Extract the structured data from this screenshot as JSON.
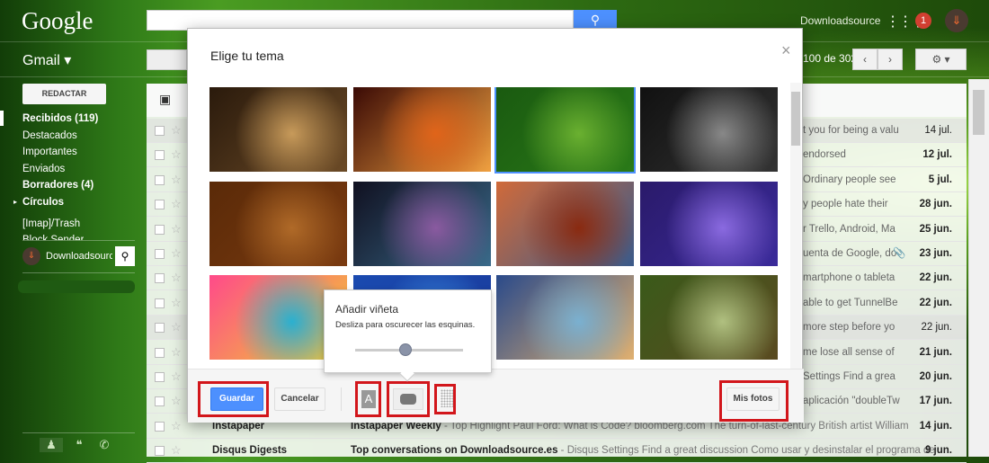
{
  "header": {
    "logo": "Google",
    "search_button_icon": "search-icon",
    "username": "Downloadsource",
    "notifications": "1",
    "app_label": "Gmail ▾",
    "page_count": "100 de 302"
  },
  "sidebar": {
    "compose": "REDACTAR",
    "items": [
      {
        "label": "Recibidos (119)",
        "bold": true
      },
      {
        "label": "Destacados",
        "bold": false
      },
      {
        "label": "Importantes",
        "bold": false
      },
      {
        "label": "Enviados",
        "bold": false
      },
      {
        "label": "Borradores (4)",
        "bold": true
      },
      {
        "label": "Círculos",
        "bold": true
      },
      {
        "label": "[Imap]/Trash",
        "bold": false
      },
      {
        "label": "Block Sender",
        "bold": false
      }
    ],
    "hangouts_name": "Downloadsource"
  },
  "emails": [
    {
      "snippet": "t you for being a valu",
      "date": "14 jul.",
      "read": true
    },
    {
      "snippet": "endorsed",
      "date": "12 jul.",
      "read": false
    },
    {
      "snippet": "Ordinary people see",
      "date": "5 jul.",
      "read": false
    },
    {
      "snippet": "y people hate their",
      "date": "28 jun.",
      "read": false
    },
    {
      "snippet": "r Trello, Android, Ma",
      "date": "25 jun.",
      "read": false
    },
    {
      "snippet": "uenta de Google, do",
      "date": "23 jun.",
      "read": false,
      "attachment": true
    },
    {
      "snippet": "martphone o tableta",
      "date": "22 jun.",
      "read": false
    },
    {
      "snippet": "able to get TunnelBe",
      "date": "22 jun.",
      "read": false
    },
    {
      "snippet": "more step before yo",
      "date": "22 jun.",
      "read": true
    },
    {
      "snippet": "me lose all sense of",
      "date": "21 jun.",
      "read": false
    },
    {
      "snippet": "Settings Find a grea",
      "date": "20 jun.",
      "read": false
    },
    {
      "snippet": "aplicación \"doubleTw",
      "date": "17 jun.",
      "read": false
    },
    {
      "sender": "Instapaper",
      "subject": "Instapaper Weekly",
      "snippet": " - Top Highlight Paul Ford: What is Code? bloomberg.com The turn-of-last-century British artist William",
      "date": "14 jun.",
      "read": false
    },
    {
      "sender": "Disqus Digests",
      "subject": "Top conversations on Downloadsource.es",
      "snippet": " - Disqus Settings Find a great discussion Como usar y desinstalar el programa de",
      "date": "9 jun.",
      "read": false
    }
  ],
  "dialog": {
    "title": "Elige tu tema",
    "close": "×",
    "save": "Guardar",
    "cancel": "Cancelar",
    "my_photos": "Mis fotos",
    "text_icon": "A",
    "vignette_popup": {
      "title": "Añadir viñeta",
      "description": "Desliza para oscurecer las esquinas.",
      "level": 0.5
    },
    "themes": [
      {
        "name": "chess",
        "colors": [
          "#2a1a0c",
          "#c79a5a",
          "#6b4a26"
        ]
      },
      {
        "name": "canyon",
        "colors": [
          "#3a0a05",
          "#e0641a",
          "#f0a040"
        ]
      },
      {
        "name": "caterpillar",
        "colors": [
          "#1a5a10",
          "#6ab030",
          "#2a7a18"
        ],
        "selected": true
      },
      {
        "name": "tubes",
        "colors": [
          "#111",
          "#888",
          "#333"
        ]
      },
      {
        "name": "leaves",
        "colors": [
          "#5a2a08",
          "#b06a28",
          "#7a3a10"
        ]
      },
      {
        "name": "bokeh",
        "colors": [
          "#101020",
          "#8a5aa0",
          "#3a6a8a"
        ]
      },
      {
        "name": "grand-canyon",
        "colors": [
          "#d06a3a",
          "#8a2a10",
          "#3a5a8a"
        ]
      },
      {
        "name": "jellyfish",
        "colors": [
          "#2a1a6a",
          "#8a6ae0",
          "#3a2a9a"
        ]
      },
      {
        "name": "water-drop",
        "colors": [
          "#ff4a8a",
          "#2ab0d0",
          "#f0d030"
        ]
      },
      {
        "name": "blue-sky",
        "colors": [
          "#1a4ab0",
          "#3a8ae0",
          "#1a3a9a"
        ]
      },
      {
        "name": "beach",
        "colors": [
          "#2a4a8a",
          "#7ab0d0",
          "#e0b070"
        ]
      },
      {
        "name": "forest",
        "colors": [
          "#3a5a1a",
          "#b0c080",
          "#5a4a20"
        ]
      },
      {
        "name": "row4a",
        "colors": [
          "#333",
          "#555",
          "#222"
        ]
      },
      {
        "name": "row4b",
        "colors": [
          "#1a4ab0",
          "#3a8ae0",
          "#1a3a9a"
        ]
      },
      {
        "name": "row4c",
        "colors": [
          "#2a4a8a",
          "#5a8ad0",
          "#3a5aa0"
        ]
      },
      {
        "name": "row4d",
        "colors": [
          "#1a2a5a",
          "#3a5a9a",
          "#2a3a6a"
        ]
      }
    ]
  }
}
